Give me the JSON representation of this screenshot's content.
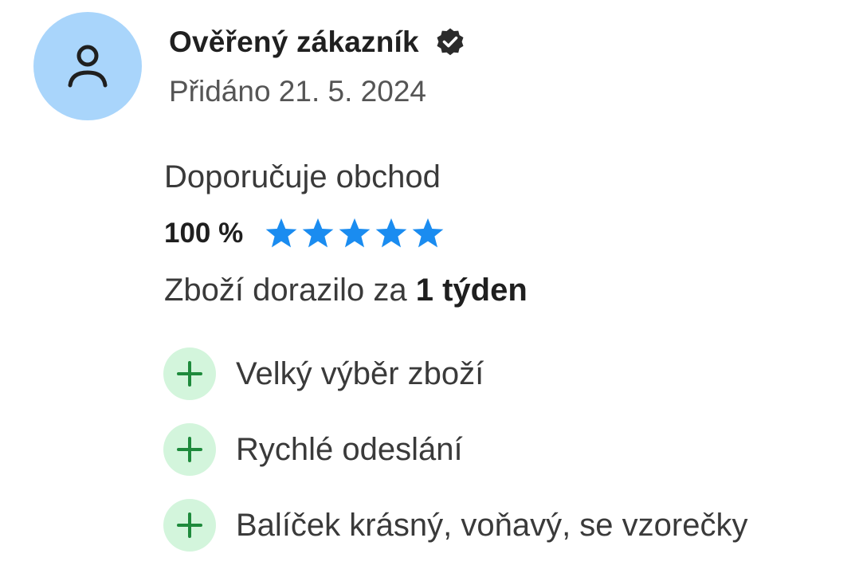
{
  "review": {
    "author_name": "Ověřený zákazník",
    "added_date": "Přidáno 21. 5. 2024",
    "recommends_label": "Doporučuje obchod",
    "recommend_percent": "100 %",
    "stars": 5,
    "delivery_prefix": "Zboží dorazilo za",
    "delivery_time": "1 týden",
    "pros": [
      {
        "text": "Velký výběr zboží"
      },
      {
        "text": "Rychlé odeslání"
      },
      {
        "text": "Balíček krásný, voňavý, se vzorečky"
      }
    ]
  },
  "icons": {
    "avatar": "user-icon",
    "verified": "verified-check-icon",
    "star": "star-icon",
    "pro": "plus-icon"
  },
  "colors": {
    "avatar_bg": "#a9d5fb",
    "star": "#1a8cf0",
    "pro_badge_bg": "#d3f5dc",
    "pro_plus": "#1e8a3c"
  }
}
